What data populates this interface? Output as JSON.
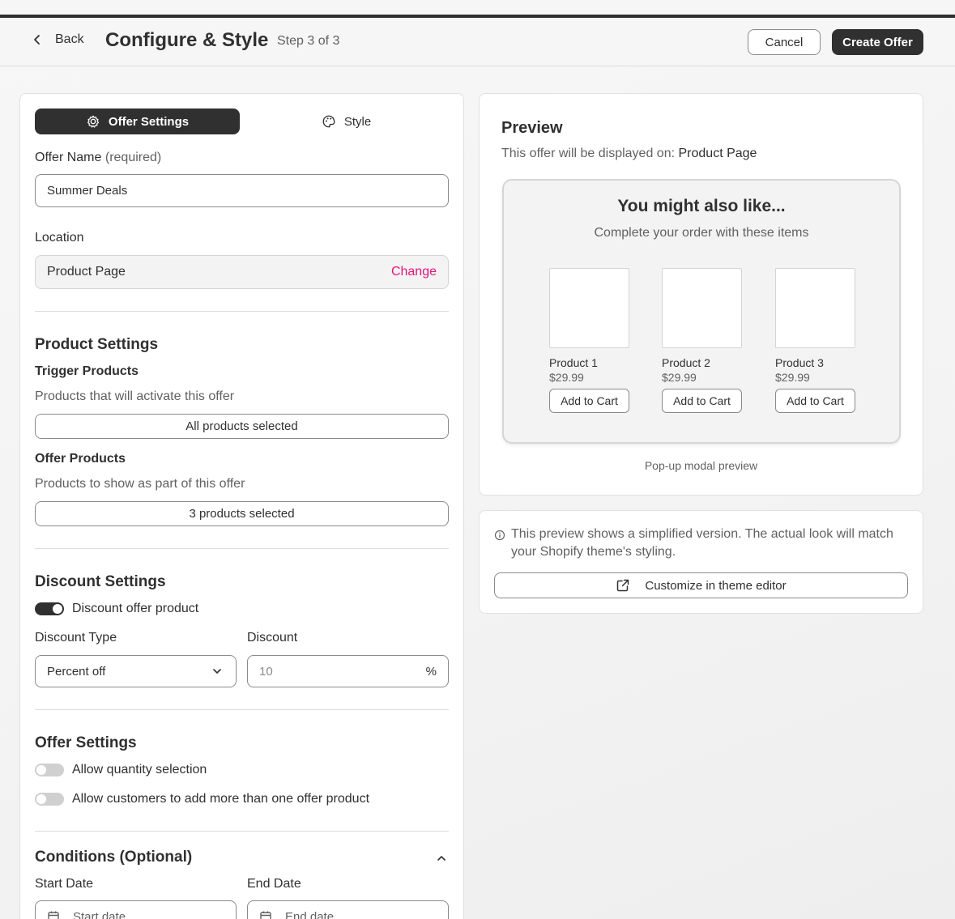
{
  "header": {
    "back_label": "Back",
    "title": "Configure & Style",
    "step": "Step 3 of 3",
    "cancel_label": "Cancel",
    "create_label": "Create Offer"
  },
  "tabs": {
    "offer_settings": "Offer Settings",
    "style": "Style",
    "active": "Offer Settings"
  },
  "offer_name": {
    "label": "Offer Name",
    "label_suffix": "(required)",
    "value": "Summer Deals"
  },
  "location": {
    "label": "Location",
    "value": "Product Page",
    "change_label": "Change"
  },
  "product_settings": {
    "title": "Product Settings",
    "trigger_title": "Trigger Products",
    "trigger_help": "Products that will activate this offer",
    "trigger_value": "All products selected",
    "offer_title": "Offer Products",
    "offer_help": "Products to show as part of this offer",
    "offer_value": "3 products selected"
  },
  "discount_settings": {
    "title": "Discount Settings",
    "toggle_label": "Discount offer product",
    "toggle_on": true,
    "type_label": "Discount Type",
    "type_value": "Percent off",
    "discount_label": "Discount",
    "discount_placeholder": "10",
    "discount_suffix": "%"
  },
  "offer_settings": {
    "title": "Offer Settings",
    "quantity_label": "Allow quantity selection",
    "quantity_on": false,
    "multi_label": "Allow customers to add more than one offer product",
    "multi_on": false
  },
  "conditions": {
    "title": "Conditions (Optional)",
    "start_label": "Start Date",
    "start_placeholder": "Start date",
    "end_label": "End Date",
    "end_placeholder": "End date"
  },
  "preview": {
    "title": "Preview",
    "sub_prefix": "This offer will be displayed on:",
    "sub_location": "Product Page",
    "modal_title": "You might also like...",
    "modal_sub": "Complete your order with these items",
    "products": [
      {
        "name": "Product 1",
        "price": "$29.99",
        "button": "Add to Cart"
      },
      {
        "name": "Product 2",
        "price": "$29.99",
        "button": "Add to Cart"
      },
      {
        "name": "Product 3",
        "price": "$29.99",
        "button": "Add to Cart"
      }
    ],
    "caption": "Pop-up modal preview"
  },
  "info": {
    "text": "This preview shows a simplified version. The actual look will match your Shopify theme's styling.",
    "customize_label": "Customize in theme editor"
  },
  "colors": {
    "primary": "#303030",
    "accent": "#e0157a",
    "muted": "#616161"
  }
}
